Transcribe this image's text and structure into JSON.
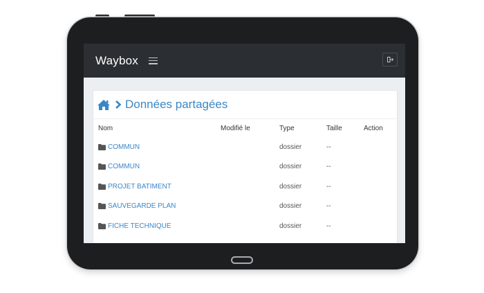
{
  "navbar": {
    "brand": "Waybox",
    "menu_icon": "hamburger-icon",
    "logout_icon": "logout-icon"
  },
  "header": {
    "home_icon": "home-icon",
    "separator_icon": "chevron-right-icon",
    "title": "Données partagées"
  },
  "table": {
    "columns": {
      "name": "Nom",
      "modified": "Modifié le",
      "type": "Type",
      "size": "Taille",
      "action": "Action"
    },
    "rows": [
      {
        "name": "COMMUN",
        "modified": "",
        "type": "dossier",
        "size": "--"
      },
      {
        "name": "COMMUN",
        "modified": "",
        "type": "dossier",
        "size": "--"
      },
      {
        "name": "PROJET BATIMENT",
        "modified": "",
        "type": "dossier",
        "size": "--"
      },
      {
        "name": "SAUVEGARDE PLAN",
        "modified": "",
        "type": "dossier",
        "size": "--"
      },
      {
        "name": "FICHE TECHNIQUE",
        "modified": "",
        "type": "dossier",
        "size": "--"
      }
    ]
  },
  "colors": {
    "navbar": "#2b2f33",
    "accent": "#3a87c6",
    "device": "#1d1e20"
  }
}
